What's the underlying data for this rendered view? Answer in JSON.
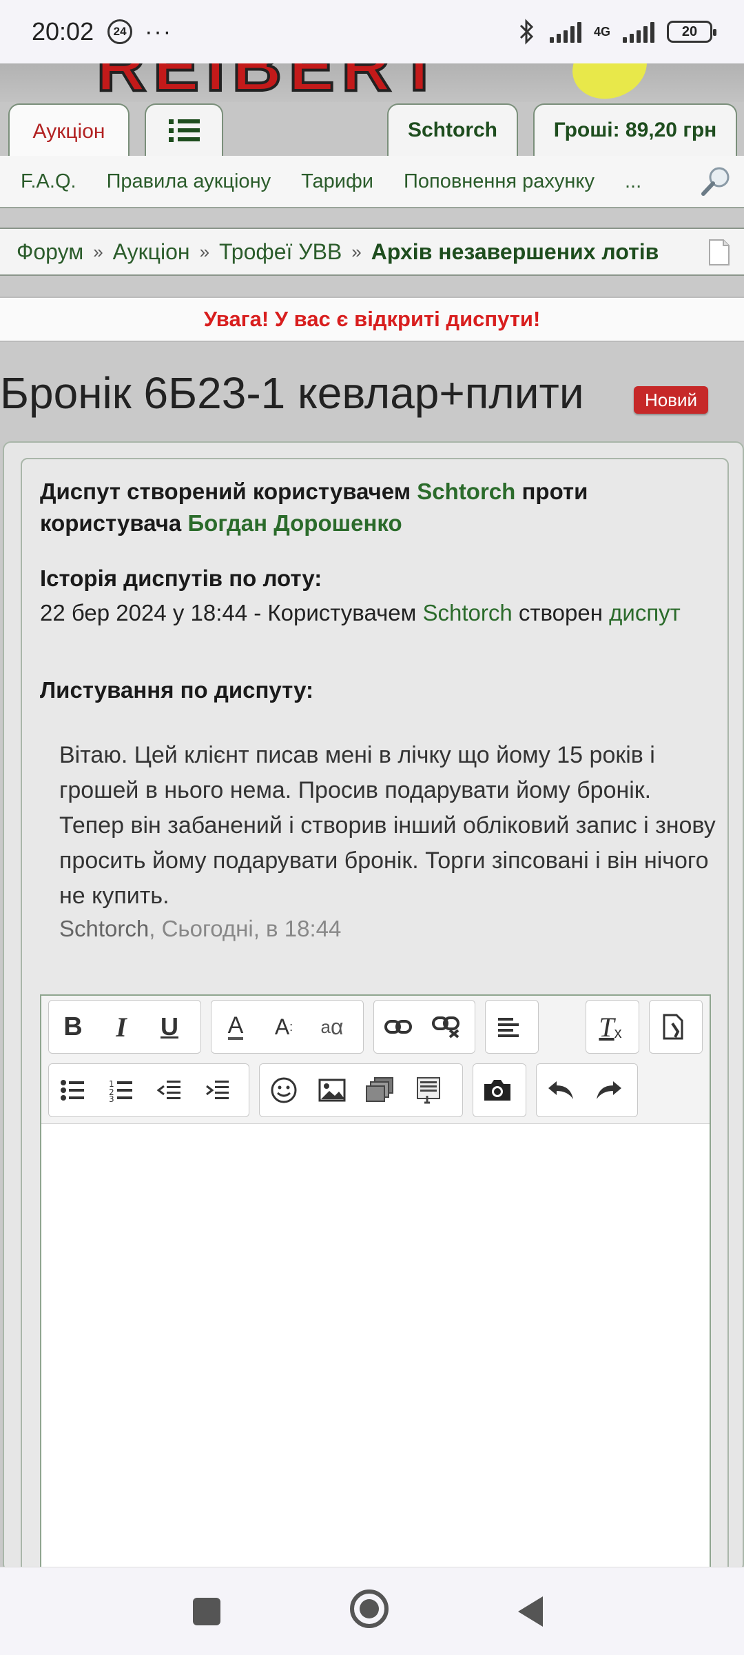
{
  "status_bar": {
    "time": "20:02",
    "notification_count": "24",
    "more": "···",
    "network": "4G",
    "battery": "20"
  },
  "header": {
    "logo_text": "REIBERT"
  },
  "tabs": {
    "auction": "Аукціон",
    "user": "Schtorch",
    "money": "Гроші: 89,20 грн"
  },
  "nav": {
    "items": [
      "F.A.Q.",
      "Правила аукціону",
      "Тарифи",
      "Поповнення рахунку",
      "..."
    ]
  },
  "breadcrumb": {
    "items": [
      "Форум",
      "Аукціон",
      "Трофеї УВВ"
    ],
    "separator": "»",
    "current": "Архів незавершених лотів"
  },
  "alert": {
    "text": "Увага! У вас є відкриті диспути!"
  },
  "page": {
    "title": "Бронік 6Б23-1 кевлар+плити",
    "badge": "Новий"
  },
  "dispute": {
    "head_prefix": "Диспут створений користувачем",
    "creator": "Schtorch",
    "head_middle": "проти користувача",
    "opponent": "Богдан Дорошенко",
    "history_title": "Історія диспутів по лоту:",
    "history_date": "22 бер 2024 у 18:44 - Користувачем",
    "history_user": "Schtorch",
    "history_action": "створен",
    "history_link": "диспут",
    "correspondence_title": "Листування по диспуту:",
    "message": "Вітаю. Цей клієнт писав мені в лічку що йому 15 років і грошей в нього нема. Просив подарувати йому бронік. Тепер він забанений і створив інший обліковий запис і знову просить йому подарувати бронік. Торги зіпсовані і він нічого не купить.",
    "message_author": "Schtorch",
    "message_time": ", Сьогодні, в 18:44"
  },
  "editor": {
    "bold": "B",
    "italic": "I",
    "underline": "U",
    "text_color": "A",
    "font_size": "A",
    "font_family": "a",
    "remove_format": "T"
  },
  "colors": {
    "accent_green": "#2b6b2b",
    "alert_red": "#d81e1e",
    "badge_red": "#c62828"
  }
}
